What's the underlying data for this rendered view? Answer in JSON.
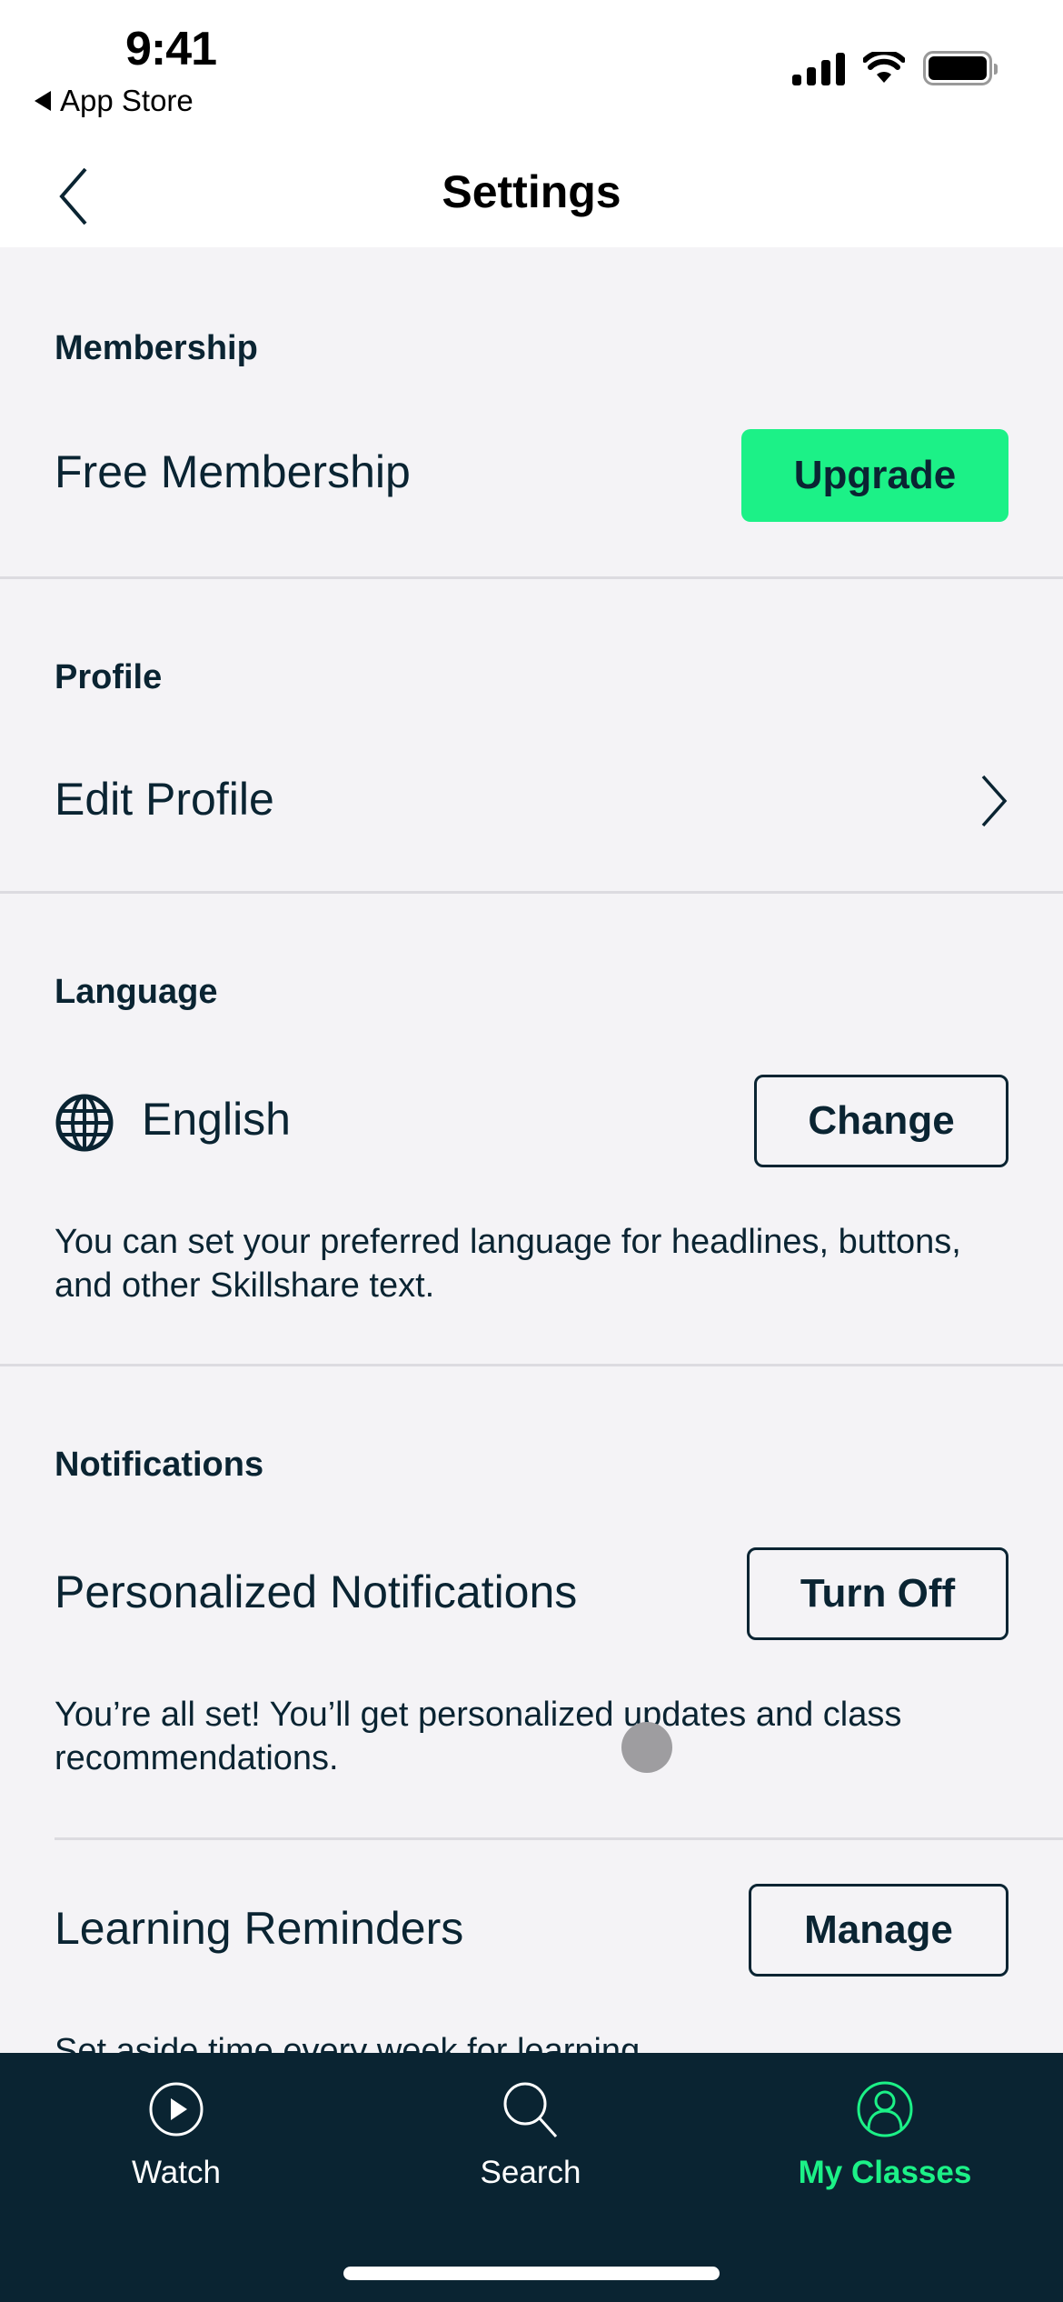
{
  "status_bar": {
    "time": "9:41",
    "back_app": "App Store",
    "icons": [
      "signal-icon",
      "wifi-icon",
      "battery-icon"
    ]
  },
  "nav": {
    "title": "Settings",
    "back_icon": "chevron-left-icon"
  },
  "sections": {
    "membership": {
      "title": "Membership",
      "row_label": "Free Membership",
      "button_label": "Upgrade"
    },
    "profile": {
      "title": "Profile",
      "row_label": "Edit Profile",
      "icon": "chevron-right-icon"
    },
    "language": {
      "title": "Language",
      "icon": "globe-icon",
      "row_label": "English",
      "button_label": "Change",
      "description": "You can set your preferred language for headlines, buttons, and other Skillshare text."
    },
    "notifications": {
      "title": "Notifications",
      "personalized": {
        "row_label": "Personalized Notifications",
        "button_label": "Turn Off",
        "description": "You’re all set! You’ll get personalized updates and class recommendations."
      },
      "reminders": {
        "row_label": "Learning Reminders",
        "button_label": "Manage",
        "description": "Set aside time every week for learning"
      }
    }
  },
  "tab_bar": {
    "tabs": [
      {
        "label": "Watch",
        "icon": "play-circle-icon",
        "active": false
      },
      {
        "label": "Search",
        "icon": "search-icon",
        "active": false
      },
      {
        "label": "My Classes",
        "icon": "user-circle-icon",
        "active": true
      }
    ]
  },
  "colors": {
    "accent": "#1cf187",
    "text": "#0a2432",
    "background": "#f4f3f6",
    "tab_bar": "#0a2432"
  }
}
